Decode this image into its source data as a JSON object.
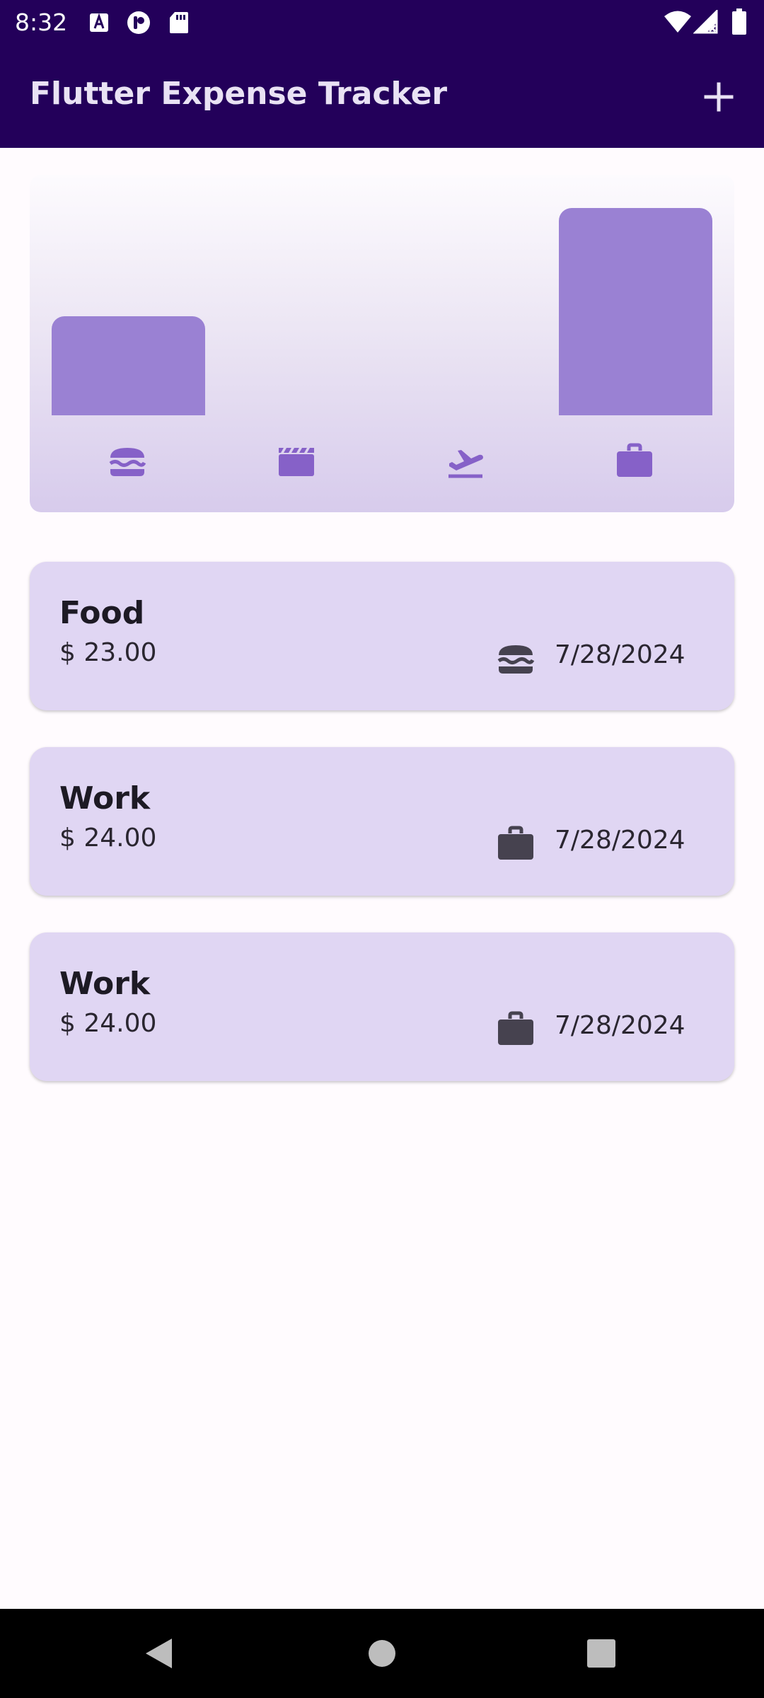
{
  "status_bar": {
    "time": "8:32",
    "left_icons": [
      "font-download-icon",
      "app-notification-icon",
      "sd-card-icon"
    ],
    "right_icons": [
      "wifi-icon",
      "signal-icon",
      "battery-icon"
    ]
  },
  "app_bar": {
    "title": "Flutter Expense Tracker",
    "add_icon": "add-icon"
  },
  "chart_data": {
    "type": "bar",
    "categories": [
      "food",
      "leisure",
      "travel",
      "work"
    ],
    "category_icons": [
      "lunch-icon",
      "movie-icon",
      "flight-takeoff-icon",
      "work-icon"
    ],
    "values": [
      23,
      0,
      0,
      48
    ],
    "title": "",
    "xlabel": "",
    "ylabel": "",
    "ylim": [
      0,
      48
    ],
    "bar_color": "#9a81d3",
    "icon_color": "#8661c8"
  },
  "expenses": [
    {
      "title": "Food",
      "amount": "$ 23.00",
      "icon": "lunch-icon",
      "date": "7/28/2024"
    },
    {
      "title": "Work",
      "amount": "$ 24.00",
      "icon": "work-icon",
      "date": "7/28/2024"
    },
    {
      "title": "Work",
      "amount": "$ 24.00",
      "icon": "work-icon",
      "date": "7/28/2024"
    }
  ],
  "nav_bar": {
    "buttons": [
      "back-icon",
      "home-icon",
      "recents-icon"
    ]
  },
  "colors": {
    "app_bar": "#23005a",
    "card": "#e0d6f3",
    "background": "#fffbfe"
  }
}
